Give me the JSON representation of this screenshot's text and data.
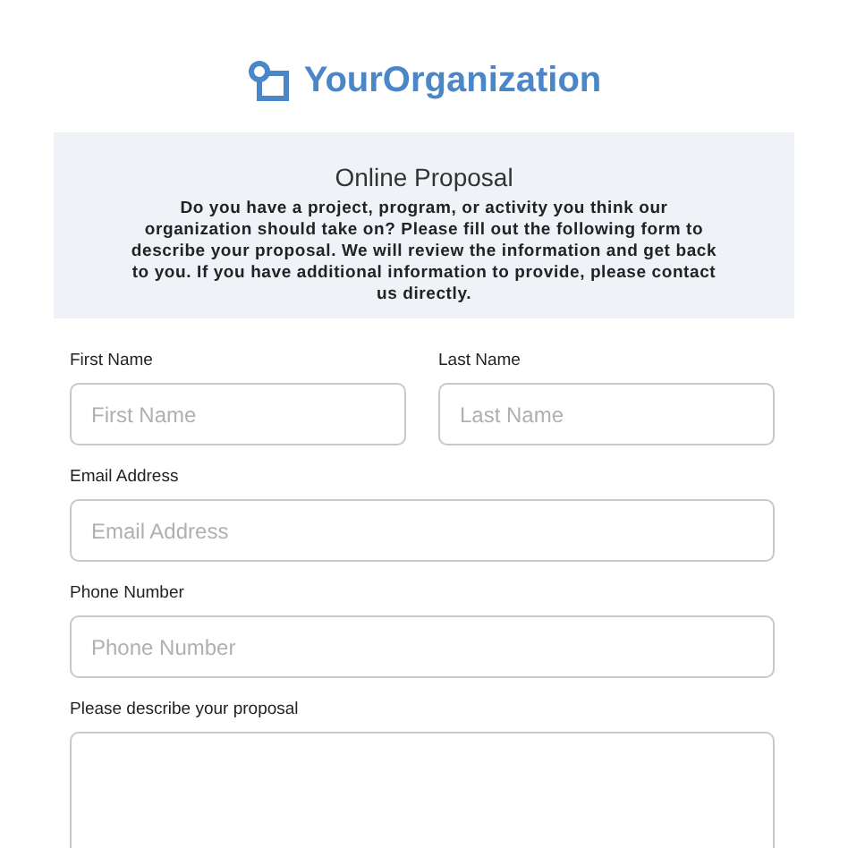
{
  "logo": {
    "text": "YourOrganization"
  },
  "intro": {
    "title": "Online Proposal",
    "description": "Do you have a project, program, or activity you think our organization should take on? Please fill out the following form to describe your proposal. We will review the information and get back to you. If you have additional information to provide, please contact us directly."
  },
  "form_rows": [
    {
      "fields": [
        {
          "kind": "text",
          "label": "First Name",
          "placeholder": "First Name"
        },
        {
          "kind": "text",
          "label": "Last Name",
          "placeholder": "Last Name"
        }
      ]
    },
    {
      "fields": [
        {
          "kind": "text",
          "label": "Email Address",
          "placeholder": "Email Address"
        }
      ]
    },
    {
      "fields": [
        {
          "kind": "text",
          "label": "Phone Number",
          "placeholder": "Phone Number"
        }
      ]
    },
    {
      "fields": [
        {
          "kind": "textarea",
          "label": "Please describe your proposal"
        }
      ]
    }
  ]
}
